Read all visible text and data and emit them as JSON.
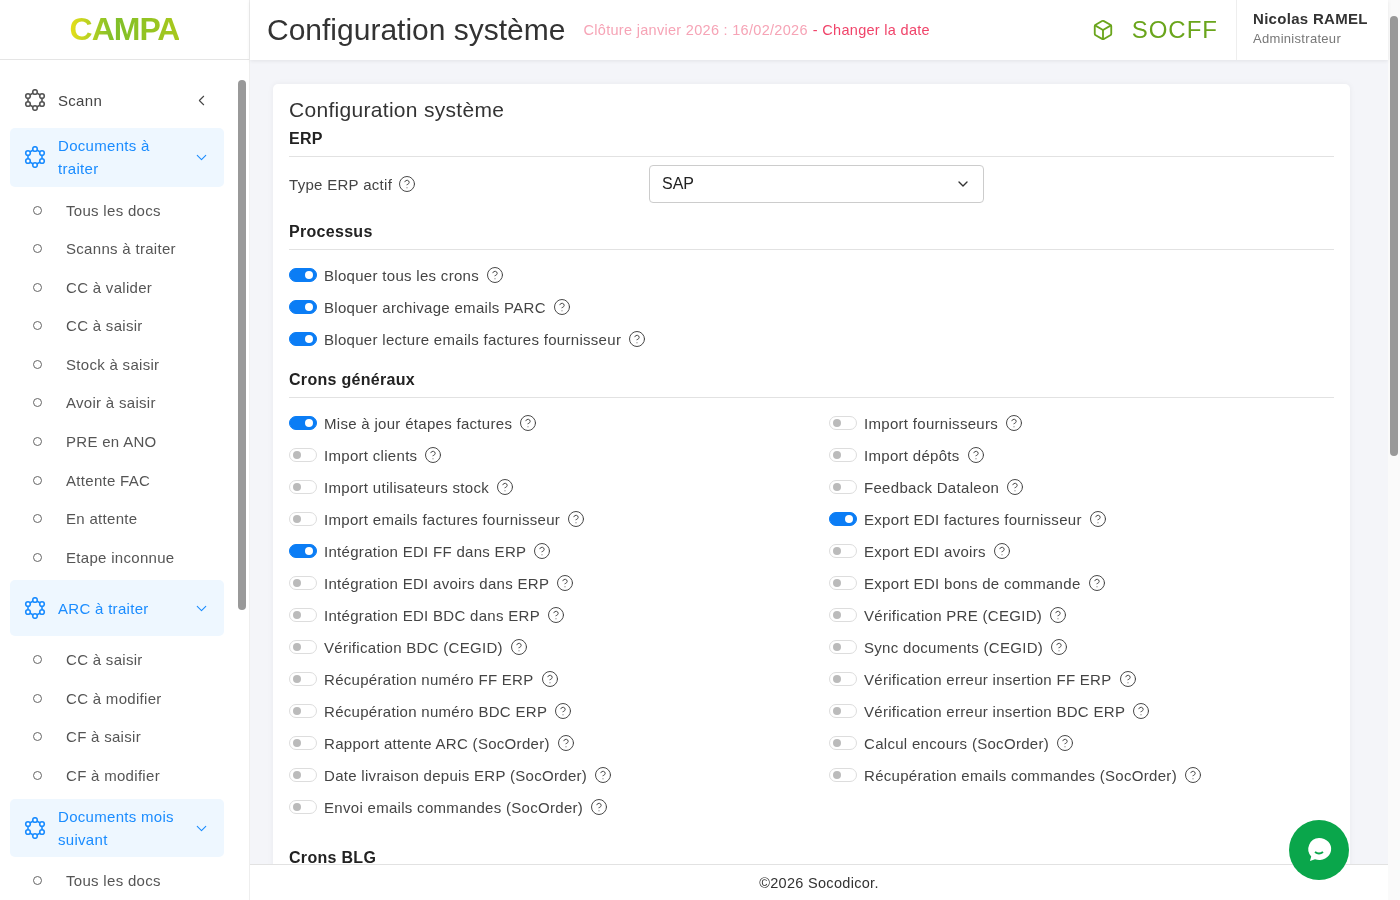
{
  "logo": "CAMPA",
  "header": {
    "title": "Configuration système",
    "closing": "Clôture janvier 2026 : 16/02/2026",
    "change_link": "- Changer la date",
    "company": "SOCFF",
    "user": {
      "name": "Nicolas RAMEL",
      "role": "Administrateur"
    }
  },
  "sidebar": {
    "groups": [
      {
        "label": "Scann",
        "expanded": false
      },
      {
        "label": "Documents à traiter",
        "expanded": true,
        "children": [
          "Tous les docs",
          "Scanns à traiter",
          "CC à valider",
          "CC à saisir",
          "Stock à saisir",
          "Avoir à saisir",
          "PRE en ANO",
          "Attente FAC",
          "En attente",
          "Etape inconnue"
        ]
      },
      {
        "label": "ARC à traiter",
        "expanded": true,
        "children": [
          "CC à saisir",
          "CC à modifier",
          "CF à saisir",
          "CF à modifier"
        ]
      },
      {
        "label": "Documents mois suivant",
        "expanded": true,
        "children": [
          "Tous les docs"
        ]
      }
    ]
  },
  "card": {
    "title": "Configuration système",
    "erp": {
      "heading": "ERP",
      "label": "Type ERP actif",
      "value": "SAP"
    },
    "processes": {
      "heading": "Processus",
      "items": [
        {
          "label": "Bloquer tous les crons",
          "on": true
        },
        {
          "label": "Bloquer archivage emails PARC",
          "on": true
        },
        {
          "label": "Bloquer lecture emails factures fournisseur",
          "on": true
        }
      ]
    },
    "general_crons": {
      "heading": "Crons généraux",
      "columns": [
        {
          "items": [
            {
              "label": "Mise à jour étapes factures",
              "on": true
            },
            {
              "label": "Import clients",
              "on": false
            },
            {
              "label": "Import utilisateurs stock",
              "on": false
            },
            {
              "label": "Import emails factures fournisseur",
              "on": false
            },
            {
              "label": "Intégration EDI FF dans ERP",
              "on": true
            },
            {
              "label": "Intégration EDI avoirs dans ERP",
              "on": false
            },
            {
              "label": "Intégration EDI BDC dans ERP",
              "on": false
            },
            {
              "label": "Vérification BDC (CEGID)",
              "on": false
            },
            {
              "label": "Récupération numéro FF ERP",
              "on": false
            },
            {
              "label": "Récupération numéro BDC ERP",
              "on": false
            },
            {
              "label": "Rapport attente ARC (SocOrder)",
              "on": false
            },
            {
              "label": "Date livraison depuis ERP (SocOrder)",
              "on": false
            },
            {
              "label": "Envoi emails commandes (SocOrder)",
              "on": false
            }
          ]
        },
        {
          "items": [
            {
              "label": "Import fournisseurs",
              "on": false
            },
            {
              "label": "Import dépôts",
              "on": false
            },
            {
              "label": "Feedback Dataleon",
              "on": false
            },
            {
              "label": "Export EDI factures fournisseur",
              "on": true
            },
            {
              "label": "Export EDI avoirs",
              "on": false
            },
            {
              "label": "Export EDI bons de commande",
              "on": false
            },
            {
              "label": "Vérification PRE (CEGID)",
              "on": false
            },
            {
              "label": "Sync documents (CEGID)",
              "on": false
            },
            {
              "label": "Vérification erreur insertion FF ERP",
              "on": false
            },
            {
              "label": "Vérification erreur insertion BDC ERP",
              "on": false
            },
            {
              "label": "Calcul encours (SocOrder)",
              "on": false
            },
            {
              "label": "Récupération emails commandes (SocOrder)",
              "on": false
            }
          ]
        }
      ]
    },
    "next_heading": "Crons BLG"
  },
  "footer": "©2026 Socodicor."
}
